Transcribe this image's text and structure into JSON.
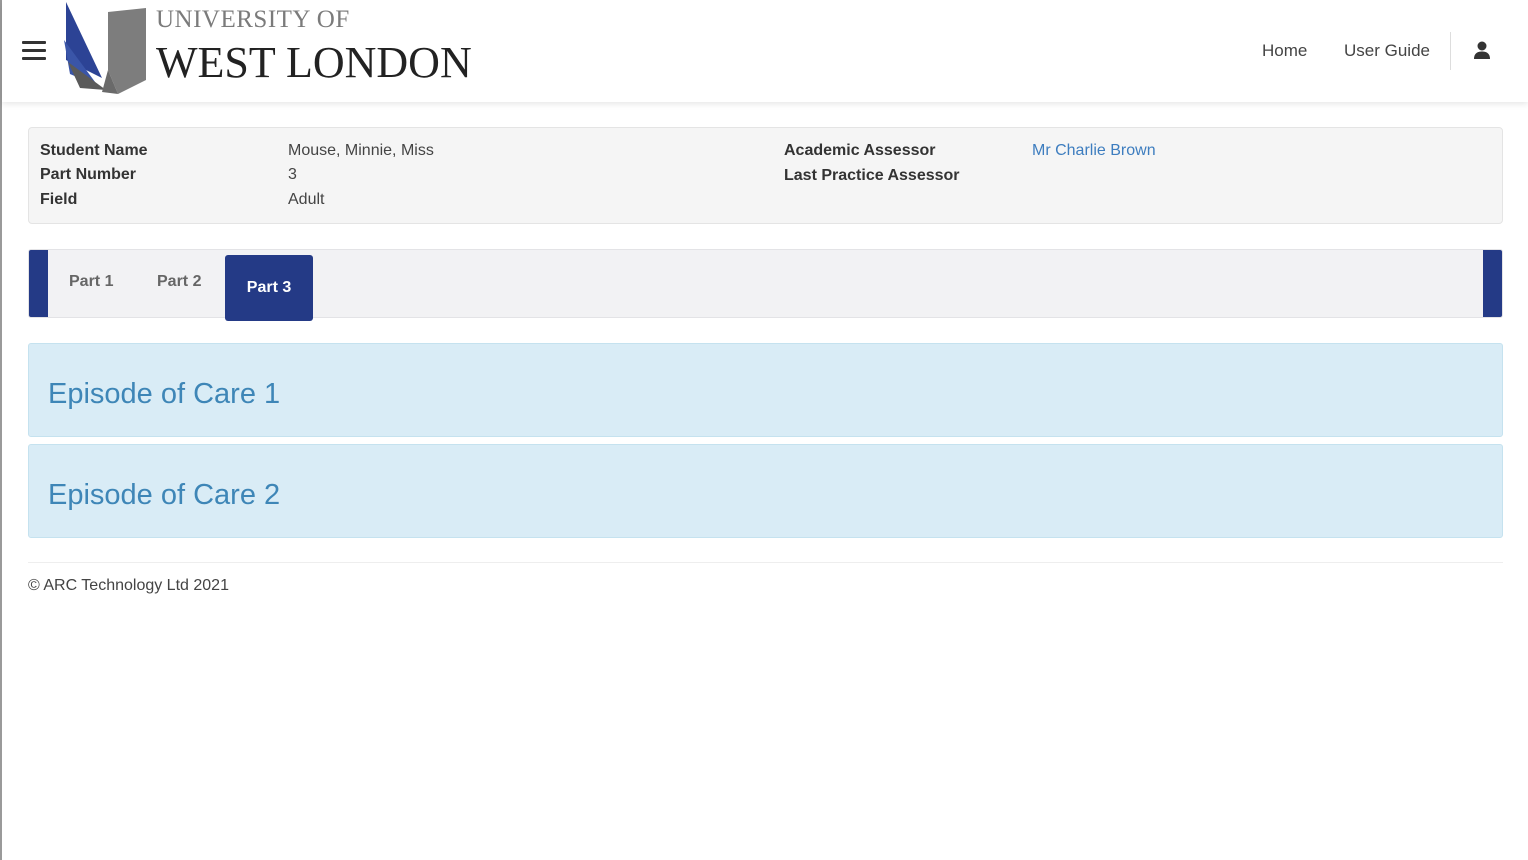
{
  "header": {
    "logo_line1": "UNIVERSITY OF",
    "logo_line2": "WEST LONDON",
    "nav": {
      "home": "Home",
      "user_guide": "User Guide"
    },
    "icons": {
      "menu": "hamburger-menu-icon",
      "user": "user-icon"
    }
  },
  "student_info": {
    "student_name_label": "Student Name",
    "student_name": "Mouse, Minnie, Miss",
    "part_number_label": "Part Number",
    "part_number": "3",
    "field_label": "Field",
    "field": "Adult",
    "academic_assessor_label": "Academic Assessor",
    "academic_assessor": "Mr Charlie Brown",
    "last_practice_assessor_label": "Last Practice Assessor",
    "last_practice_assessor": ""
  },
  "tabs": [
    {
      "label": "Part 1",
      "active": false
    },
    {
      "label": "Part 2",
      "active": false
    },
    {
      "label": "Part 3",
      "active": true
    }
  ],
  "episodes": [
    {
      "title": "Episode of Care 1"
    },
    {
      "title": "Episode of Care 2"
    }
  ],
  "footer": {
    "copyright": "© ARC Technology Ltd 2021"
  },
  "colors": {
    "brand_navy": "#243a86",
    "link_blue": "#3d7dbf",
    "episode_bg": "#d9ecf6",
    "episode_text": "#3e86b7"
  }
}
